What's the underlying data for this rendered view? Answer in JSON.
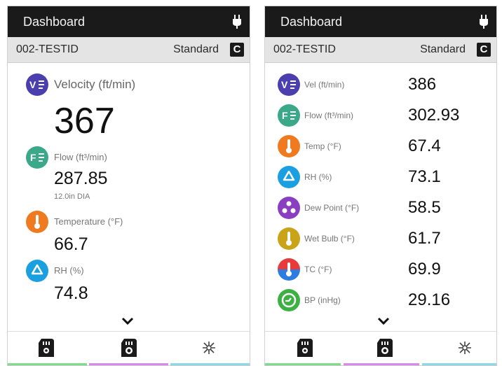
{
  "left": {
    "title": "Dashboard",
    "device_id": "002-TESTID",
    "mode": "Standard",
    "mode_button": "C",
    "velocity": {
      "label": "Velocity (ft/min)",
      "value": "367",
      "icon": "velocity-icon",
      "color": "#4b3fb0"
    },
    "flow": {
      "label": "Flow (ft³/min)",
      "value": "287.85",
      "sub": "12.0in DIA",
      "icon": "flow-icon",
      "color": "#3aa889"
    },
    "temperature": {
      "label": "Temperature (°F)",
      "value": "66.7",
      "icon": "thermometer-icon",
      "color": "#f07a20"
    },
    "rh": {
      "label": "RH (%)",
      "value": "74.8",
      "icon": "humidity-icon",
      "color": "#1aa0e0"
    }
  },
  "right": {
    "title": "Dashboard",
    "device_id": "002-TESTID",
    "mode": "Standard",
    "mode_button": "C",
    "items": [
      {
        "label": "Vel (ft/min)",
        "value": "386",
        "icon": "velocity-icon",
        "color": "#4b3fb0"
      },
      {
        "label": "Flow (ft³/min)",
        "value": "302.93",
        "icon": "flow-icon",
        "color": "#3aa889"
      },
      {
        "label": "Temp (°F)",
        "value": "67.4",
        "icon": "thermometer-icon",
        "color": "#f07a20"
      },
      {
        "label": "RH (%)",
        "value": "73.1",
        "icon": "humidity-icon",
        "color": "#1aa0e0"
      },
      {
        "label": "Dew Point (°F)",
        "value": "58.5",
        "icon": "dew-point-icon",
        "color": "#8a3fc2"
      },
      {
        "label": "Wet Bulb (°F)",
        "value": "61.7",
        "icon": "wet-bulb-icon",
        "color": "#c9a318"
      },
      {
        "label": "TC (°F)",
        "value": "69.9",
        "icon": "thermocouple-icon",
        "color": "#2b7de0"
      },
      {
        "label": "BP (inHg)",
        "value": "29.16",
        "icon": "pressure-icon",
        "color": "#3cb043"
      }
    ]
  },
  "bottom_nav": [
    "sd-card-icon",
    "camera-card-icon",
    "settings-sparkle-icon"
  ],
  "strip_colors": [
    "#7ddc8a",
    "#d98ae8",
    "#8ad8e8"
  ]
}
